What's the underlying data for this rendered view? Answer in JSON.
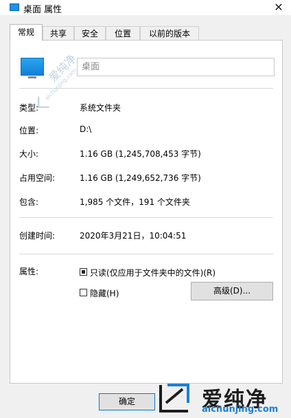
{
  "title": "桌面 属性",
  "close_glyph": "✕",
  "tabs": [
    "常规",
    "共享",
    "安全",
    "位置",
    "以前的版本"
  ],
  "name_field": {
    "value": "桌面"
  },
  "rows": [
    {
      "label": "类型:",
      "value": "系统文件夹"
    },
    {
      "label": "位置:",
      "value": "D:\\"
    },
    {
      "label": "大小:",
      "value": "1.16 GB (1,245,708,453 字节)"
    },
    {
      "label": "占用空间:",
      "value": "1.16 GB (1,249,652,736 字节)"
    },
    {
      "label": "包含:",
      "value": "1,985 个文件，191 个文件夹"
    },
    {
      "label": "创建时间:",
      "value": "2020年3月21日，10:04:51"
    }
  ],
  "attributes": {
    "label": "属性:",
    "readonly_label": "只读(仅应用于文件夹中的文件)(R)",
    "hidden_label": "隐藏(H)",
    "advanced_button": "高级(D)..."
  },
  "ok_button": "确定",
  "watermark": {
    "brand": "爱纯净",
    "url": "aichunjing.com"
  }
}
